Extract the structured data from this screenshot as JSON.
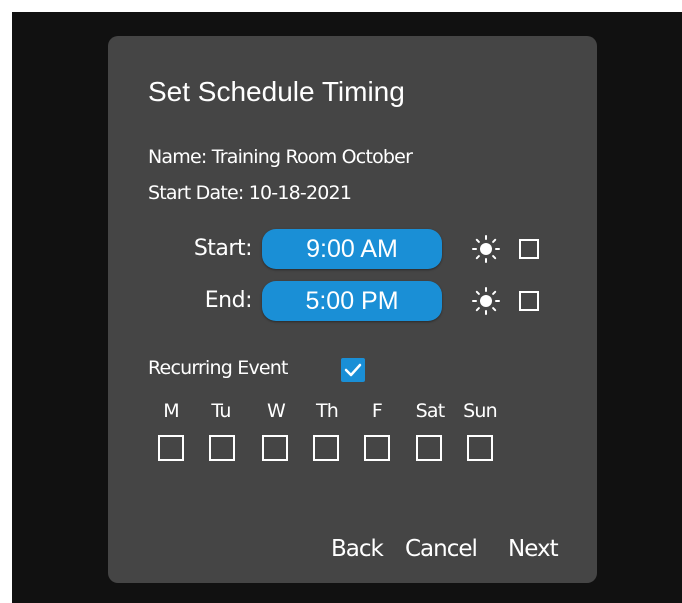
{
  "dialog": {
    "title": "Set Schedule Timing",
    "name_line": "Name: Training Room October",
    "start_date_line": "Start Date: 10-18-2021"
  },
  "times": {
    "start_label": "Start:",
    "start_value": "9:00 AM",
    "start_daylight_checked": false,
    "end_label": "End:",
    "end_value": "5:00 PM",
    "end_daylight_checked": false,
    "daylight_icon": "sun-icon"
  },
  "recurring": {
    "label": "Recurring Event",
    "checked": true,
    "days": [
      {
        "label": "M",
        "checked": false
      },
      {
        "label": "Tu",
        "checked": false
      },
      {
        "label": "W",
        "checked": false
      },
      {
        "label": "Th",
        "checked": false
      },
      {
        "label": "F",
        "checked": false
      },
      {
        "label": "Sat",
        "checked": false
      },
      {
        "label": "Sun",
        "checked": false
      }
    ]
  },
  "buttons": {
    "back": "Back",
    "cancel": "Cancel",
    "next": "Next"
  },
  "colors": {
    "accent": "#1a8fd6",
    "dialog_bg": "#454545",
    "backdrop": "#111111"
  }
}
